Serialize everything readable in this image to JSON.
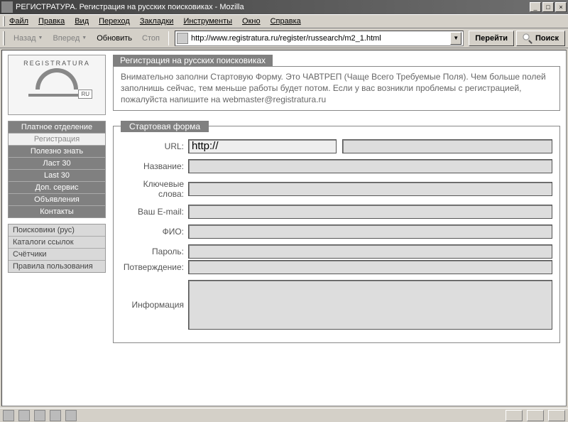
{
  "window": {
    "title": "РЕГИСТРАТУРА. Регистрация на русских поисковиках - Mozilla"
  },
  "menu": {
    "items": [
      "Файл",
      "Правка",
      "Вид",
      "Переход",
      "Закладки",
      "Инструменты",
      "Окно",
      "Справка"
    ]
  },
  "toolbar": {
    "back": "Назад",
    "forward": "Вперед",
    "reload": "Обновить",
    "stop": "Стоп",
    "url": "http://www.registratura.ru/register/russearch/m2_1.html",
    "go": "Перейти",
    "search": "Поиск"
  },
  "logo": {
    "text": "REGISTRATURA",
    "badge": "RU"
  },
  "nav1": [
    {
      "label": "Платное отделение",
      "style": "dark"
    },
    {
      "label": "Регистрация",
      "style": "sel"
    },
    {
      "label": "Полезно знать",
      "style": "dark"
    },
    {
      "label": "Ласт 30",
      "style": "dark"
    },
    {
      "label": "Last 30",
      "style": "dark"
    },
    {
      "label": "Доп. сервис",
      "style": "dark"
    },
    {
      "label": "Объявления",
      "style": "dark"
    },
    {
      "label": "Контакты",
      "style": "dark"
    }
  ],
  "nav2": [
    {
      "label": "Поисковики (рус)"
    },
    {
      "label": "Каталоги ссылок"
    },
    {
      "label": "Счётчики"
    },
    {
      "label": "Правила пользования"
    }
  ],
  "page": {
    "header_tab": "Регистрация на русских поисковиках",
    "intro": "Внимательно заполни Стартовую Форму. Это ЧАВТРЕП (Чаще Всего Требуемые Поля). Чем больше полей заполнишь сейчас, тем меньше работы будет потом. Если у вас возникли проблемы с регистрацией, пожалуйста напишите на webmaster@registratura.ru",
    "form_legend": "Стартовая форма",
    "fields": {
      "url_label": "URL:",
      "url_value": "http://",
      "name_label": "Название:",
      "keywords_label1": "Ключевые",
      "keywords_label2": "слова:",
      "email_label": "Ваш E-mail:",
      "fio_label": "ФИО:",
      "password_label": "Пароль:",
      "confirm_label": "Потверждение:",
      "info_label": "Информация"
    }
  }
}
